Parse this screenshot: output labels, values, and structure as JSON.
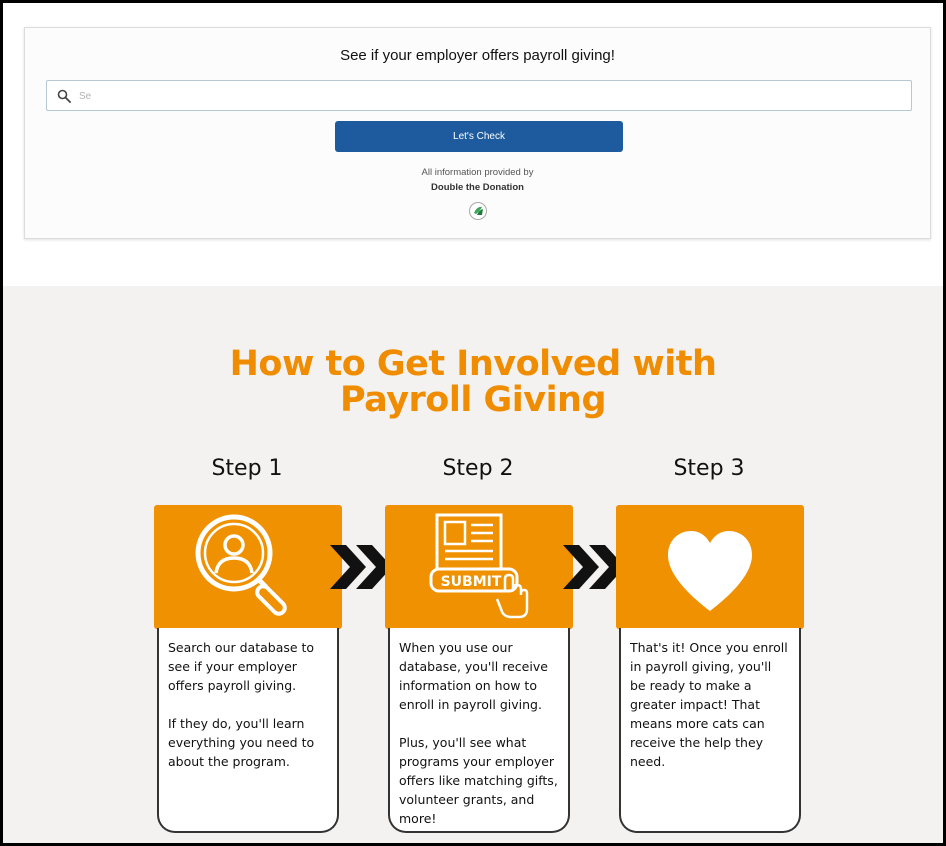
{
  "lookup": {
    "title": "See if your employer offers payroll giving!",
    "search_placeholder": "Se",
    "button_label": "Let's Check",
    "provided_by": "All information provided by",
    "provider_name": "Double the Donation"
  },
  "howto": {
    "headline_line1": "How to Get Involved with",
    "headline_line2": "Payroll Giving",
    "steps": [
      {
        "label": "Step 1",
        "icon": "magnifier-person-icon",
        "paragraphs": [
          "Search our database to see if your employer offers payroll giving.",
          "If they do, you'll learn everything you need to about the program."
        ]
      },
      {
        "label": "Step 2",
        "icon": "submit-form-icon",
        "icon_text": "SUBMIT",
        "paragraphs": [
          "When you use our database, you'll receive information on how to enroll in payroll giving.",
          "Plus, you'll see what programs your employer offers like matching gifts, volunteer grants, and more!"
        ]
      },
      {
        "label": "Step 3",
        "icon": "heart-icon",
        "paragraphs": [
          "That's it! Once you enroll in payroll giving, you'll be ready to make a greater impact! That means more cats can receive the help they need."
        ]
      }
    ]
  },
  "colors": {
    "accent_orange": "#ef9100",
    "button_blue": "#1d5b9e",
    "section_bg": "#f4f2f0"
  }
}
